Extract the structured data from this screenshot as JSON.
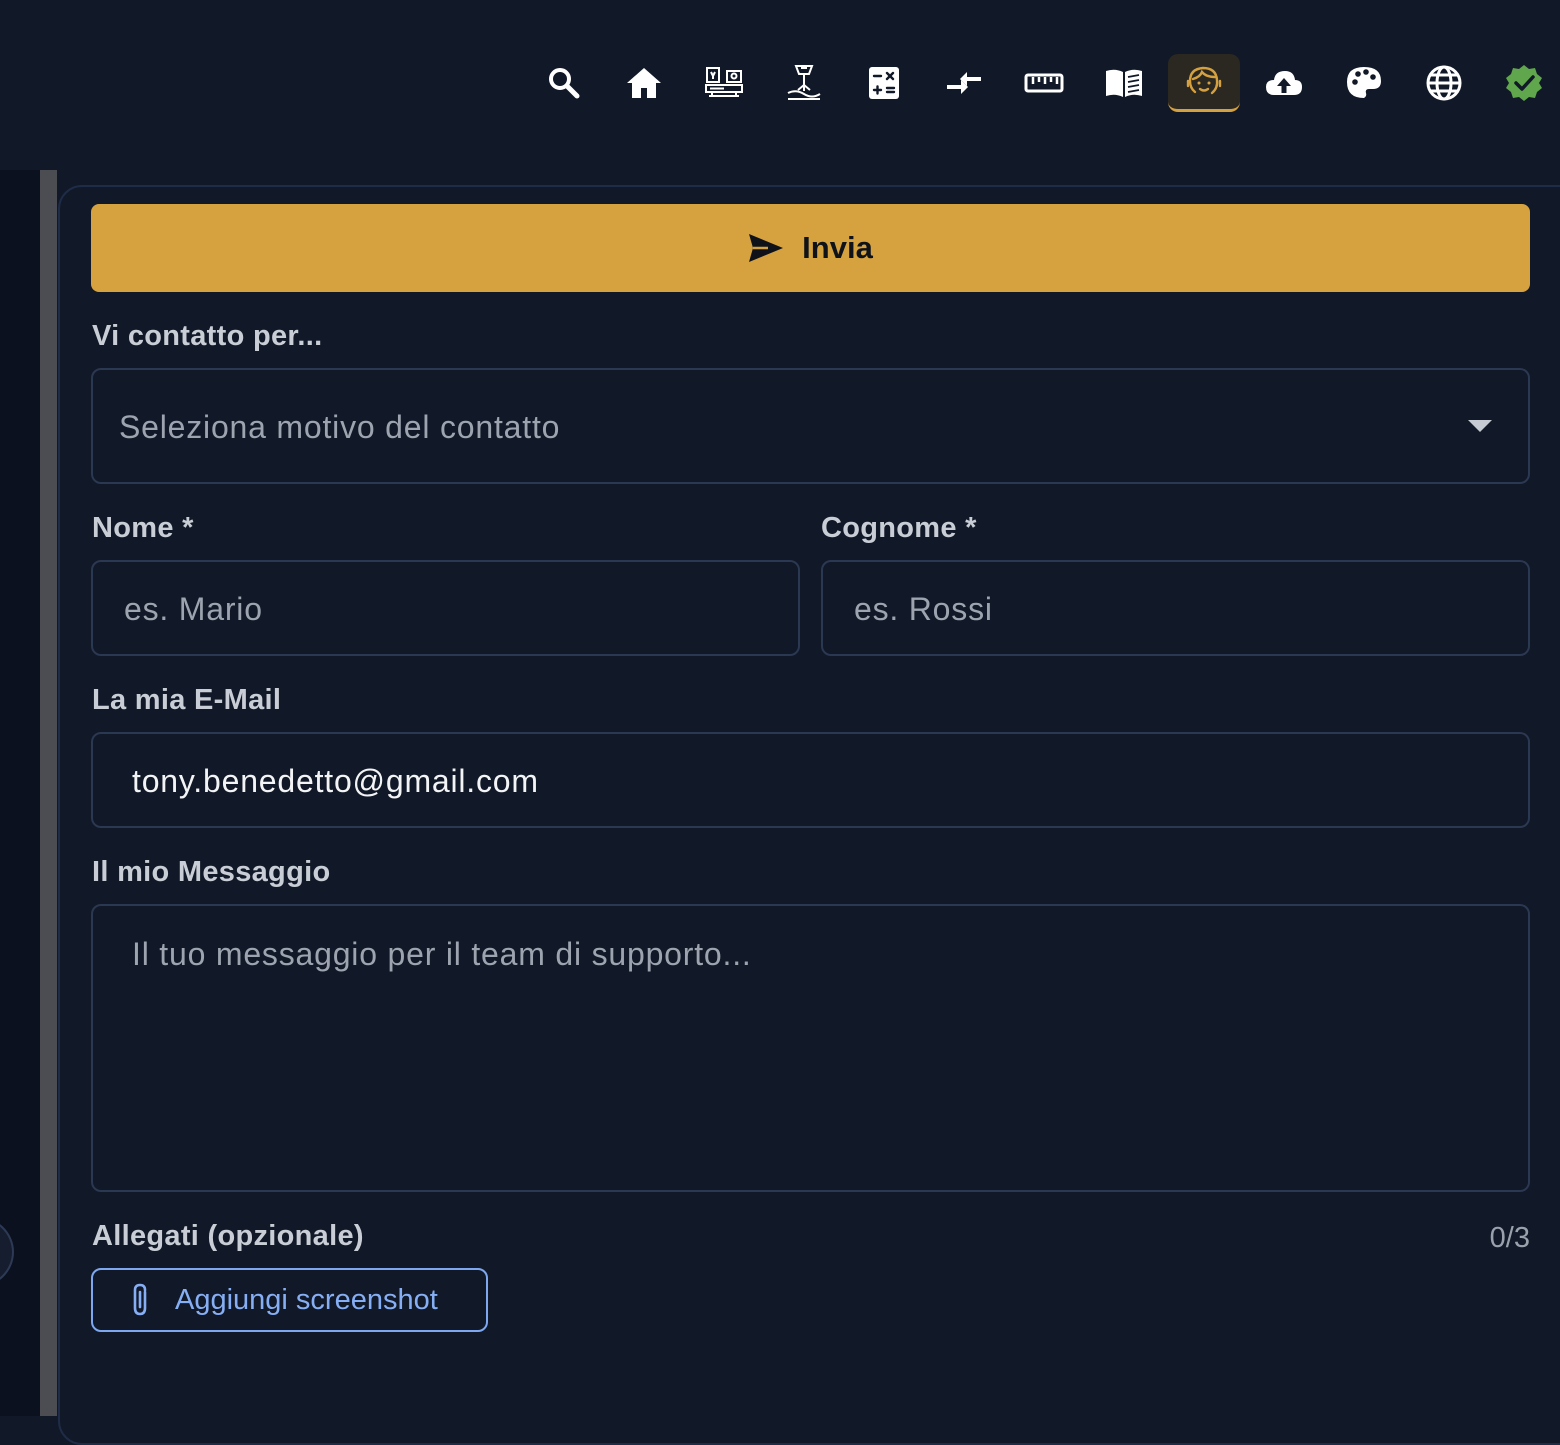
{
  "nav": {
    "icons": [
      {
        "name": "search-icon",
        "active": false
      },
      {
        "name": "home-icon",
        "active": false
      },
      {
        "name": "machines-icon",
        "active": false
      },
      {
        "name": "laser-icon",
        "active": false
      },
      {
        "name": "calculator-icon",
        "active": false
      },
      {
        "name": "compare-arrows-icon",
        "active": false
      },
      {
        "name": "ruler-icon",
        "active": false
      },
      {
        "name": "book-icon",
        "active": false
      },
      {
        "name": "support-face-icon",
        "active": true
      },
      {
        "name": "cloud-upload-icon",
        "active": false
      },
      {
        "name": "palette-icon",
        "active": false
      },
      {
        "name": "globe-icon",
        "active": false
      },
      {
        "name": "verified-badge-icon",
        "active": false
      }
    ],
    "active_color": "#d5a040",
    "verified_color": "#5fa64d"
  },
  "form": {
    "send_label": "Invia",
    "reason_label": "Vi contatto per...",
    "reason_placeholder": "Seleziona motivo del contatto",
    "first_name_label": "Nome *",
    "first_name_placeholder": "es. Mario",
    "last_name_label": "Cognome *",
    "last_name_placeholder": "es. Rossi",
    "email_label": "La mia E-Mail",
    "email_value": "tony.benedetto@gmail.com",
    "message_label": "Il mio Messaggio",
    "message_placeholder": "Il tuo messaggio per il team di supporto...",
    "attachments_label": "Allegati (opzionale)",
    "attachments_count": "0/3",
    "add_screenshot_label": "Aggiungi screenshot"
  },
  "colors": {
    "accent": "#d6a240",
    "background": "#111827",
    "link": "#86aef5"
  }
}
